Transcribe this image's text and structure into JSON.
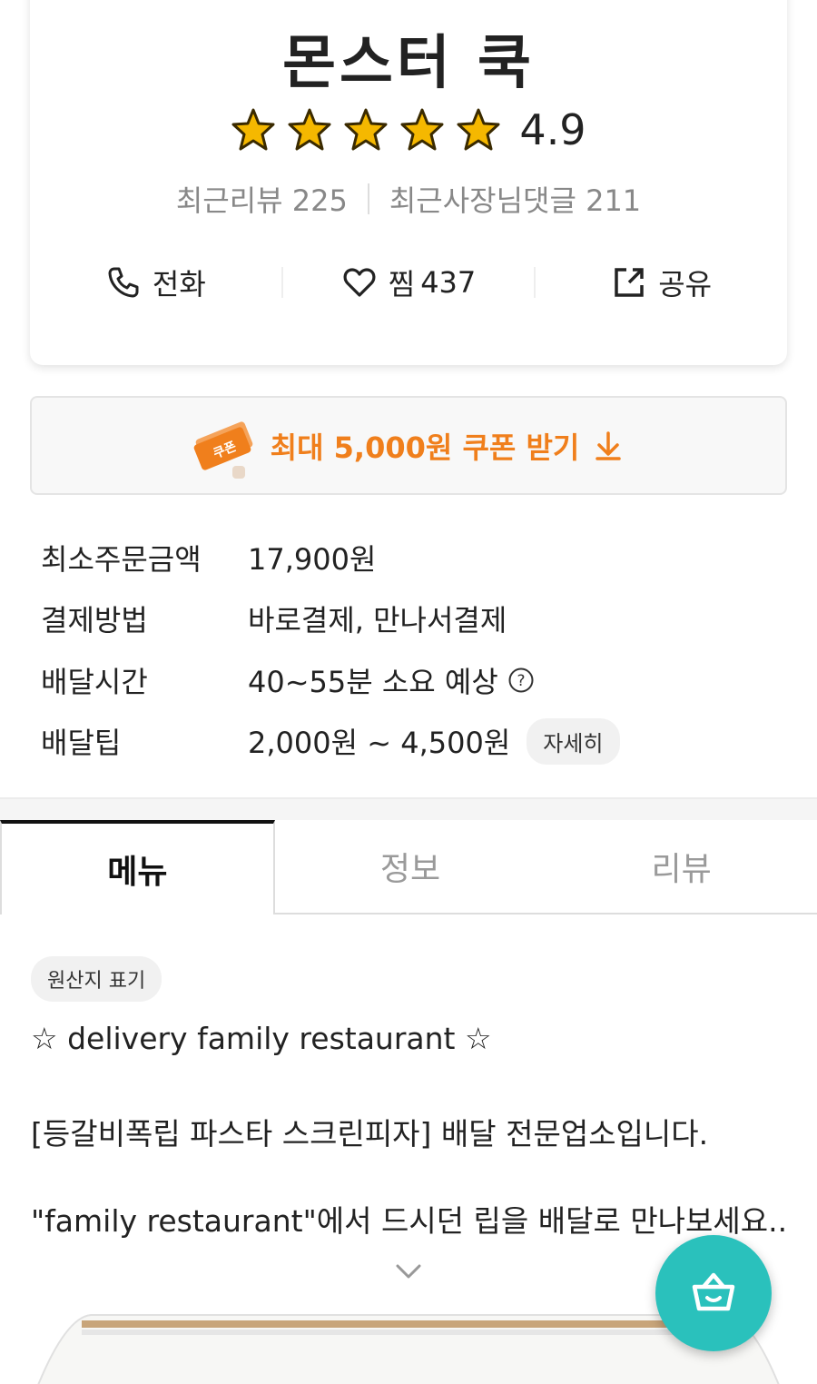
{
  "store": {
    "name": "몬스터 쿡",
    "rating": "4.9",
    "stars_filled": 5,
    "recent_reviews": "최근리뷰 225",
    "owner_replies": "최근사장님댓글 211"
  },
  "actions": {
    "call_label": "전화",
    "like_label": "찜",
    "like_count": "437",
    "share_label": "공유"
  },
  "coupon": {
    "graphic_text": "쿠폰",
    "label": "최대 5,000원 쿠폰 받기"
  },
  "info": {
    "min_order_label": "최소주문금액",
    "min_order_value": "17,900원",
    "payment_label": "결제방법",
    "payment_value": "바로결제, 만나서결제",
    "delivery_time_label": "배달시간",
    "delivery_time_value": "40~55분 소요 예상",
    "delivery_tip_label": "배달팁",
    "delivery_tip_value": "2,000원 ~ 4,500원",
    "detail_label": "자세히"
  },
  "tabs": [
    {
      "label": "메뉴",
      "active": true
    },
    {
      "label": "정보",
      "active": false
    },
    {
      "label": "리뷰",
      "active": false
    }
  ],
  "description": {
    "origin_label": "원산지 표기",
    "line1": "☆ delivery family restaurant ☆",
    "line2": "[등갈비폭립 파스타 스크린피자] 배달 전문업소입니다.",
    "line3": "\"family restaurant\"에서 드시던 립을 배달로 만나보세요..."
  },
  "colors": {
    "accent_orange": "#f07f1c",
    "cart_teal": "#2ac1bc",
    "star_gold": "#f5b800"
  }
}
